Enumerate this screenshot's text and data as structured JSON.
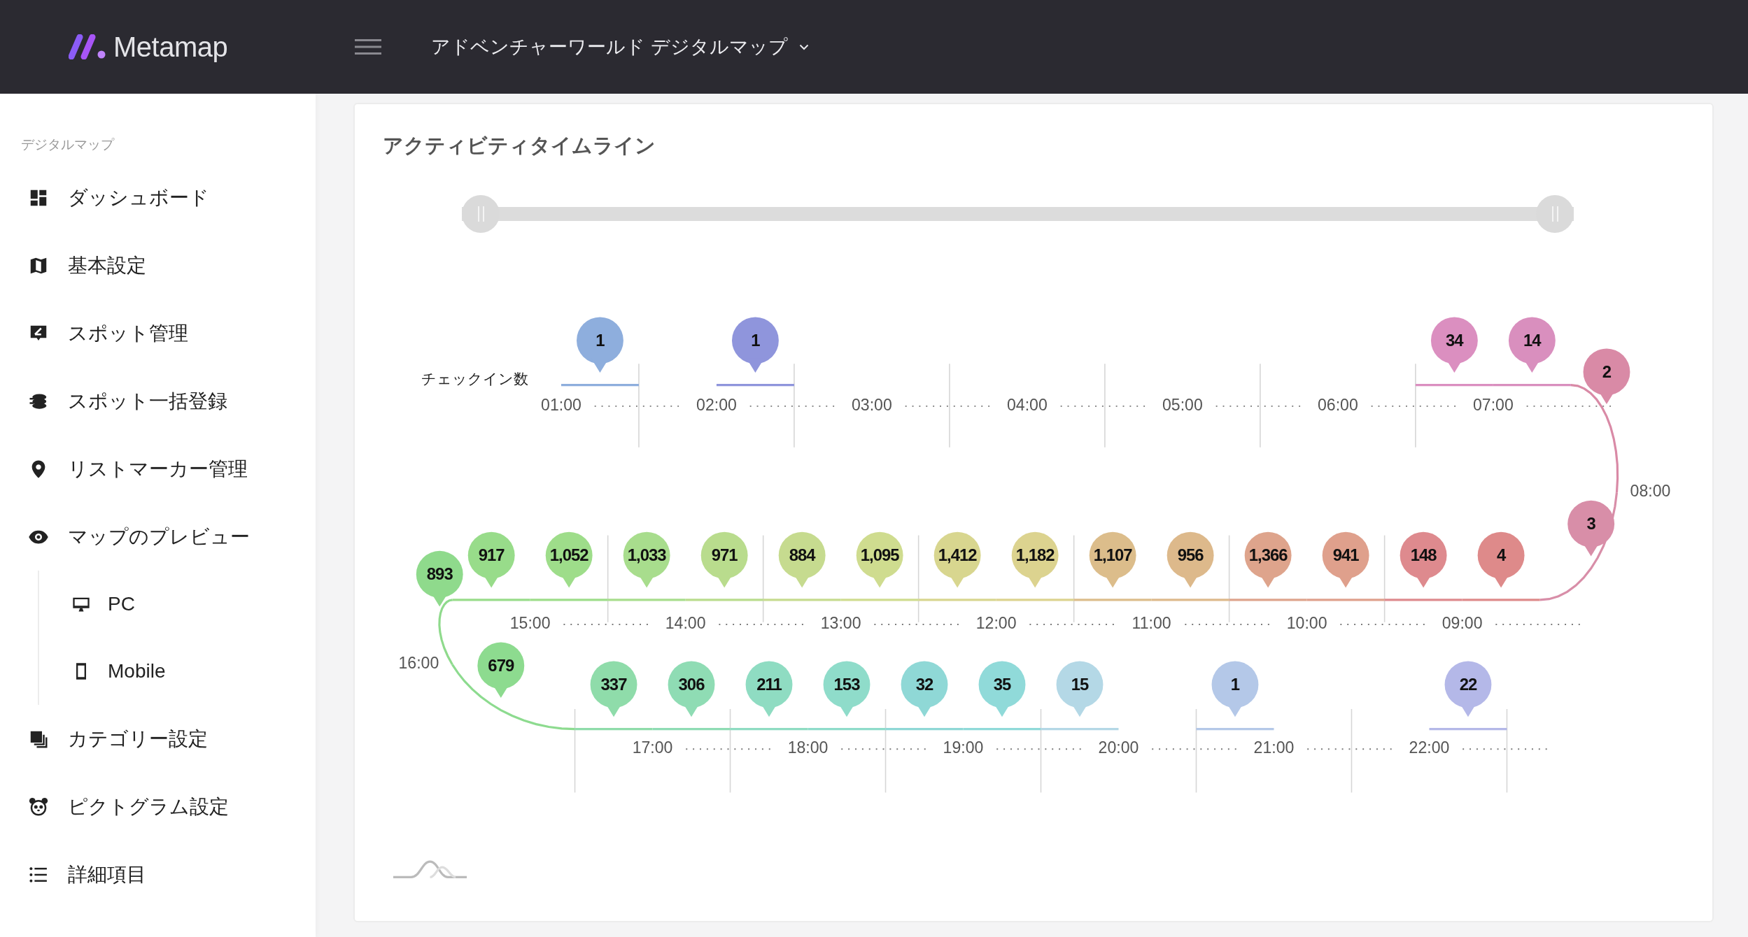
{
  "header": {
    "logo": "Metamap",
    "project": "アドベンチャーワールド デジタルマップ"
  },
  "sidebar": {
    "section": "デジタルマップ",
    "items": [
      {
        "label": "ダッシュボード",
        "kind": "dashboard"
      },
      {
        "label": "基本設定",
        "kind": "map"
      },
      {
        "label": "スポット管理",
        "kind": "spot"
      },
      {
        "label": "スポット一括登録",
        "kind": "stack"
      },
      {
        "label": "リストマーカー管理",
        "kind": "pin"
      },
      {
        "label": "マップのプレビュー",
        "kind": "eye",
        "children": [
          {
            "label": "PC",
            "kind": "monitor"
          },
          {
            "label": "Mobile",
            "kind": "phone"
          }
        ]
      },
      {
        "label": "カテゴリー設定",
        "kind": "category"
      },
      {
        "label": "ピクトグラム設定",
        "kind": "panda"
      },
      {
        "label": "詳細項目",
        "kind": "list"
      }
    ]
  },
  "card": {
    "title": "アクティビティタイムライン",
    "slider": {
      "level": 1
    },
    "timeline": {
      "label": "チェックイン数",
      "rows": [
        {
          "hours": [
            {
              "time": "01:00",
              "late": {
                "count": "1",
                "color": "#8eaedd"
              }
            },
            {
              "time": "02:00",
              "late": {
                "count": "1",
                "color": "#8f95dc"
              }
            },
            {
              "time": "03:00"
            },
            {
              "time": "04:00"
            },
            {
              "time": "05:00"
            },
            {
              "time": "06:00"
            },
            {
              "time": "07:00",
              "early": {
                "count": "34",
                "color": "#db8fc0"
              },
              "late": {
                "count": "14",
                "color": "#d98fbe"
              }
            },
            {
              "time": "08:00",
              "early": {
                "count": "2",
                "color": "#d98aa6"
              },
              "late": {
                "count": "3",
                "color": "#d88ea8"
              }
            }
          ]
        },
        {
          "hours": [
            {
              "time": "15:00",
              "late": {
                "count": "917",
                "color": "#98dc8a"
              },
              "early": {
                "count": "1,052",
                "color": "#9edd8a"
              }
            },
            {
              "time": "14:00",
              "late": {
                "count": "1,033",
                "color": "#a8dd8d"
              },
              "early": {
                "count": "971",
                "color": "#b9dc8d"
              }
            },
            {
              "time": "13:00",
              "late": {
                "count": "884",
                "color": "#c6db8f"
              },
              "early": {
                "count": "1,095",
                "color": "#cfdc8f"
              }
            },
            {
              "time": "12:00",
              "late": {
                "count": "1,412",
                "color": "#d8d68f"
              },
              "early": {
                "count": "1,182",
                "color": "#dcd38f"
              }
            },
            {
              "time": "11:00",
              "late": {
                "count": "1,107",
                "color": "#dcbd8b"
              },
              "early": {
                "count": "956",
                "color": "#ddb98b"
              }
            },
            {
              "time": "10:00",
              "late": {
                "count": "1,366",
                "color": "#dea48c"
              },
              "early": {
                "count": "941",
                "color": "#dfa08c"
              }
            },
            {
              "time": "09:00",
              "late": {
                "count": "148",
                "color": "#de8a8e"
              },
              "early": {
                "count": "4",
                "color": "#de8a8a"
              }
            }
          ]
        },
        {
          "hours": [
            {
              "time": "16:00",
              "early": {
                "count": "893",
                "color": "#8fda8c"
              },
              "late": {
                "count": "679",
                "color": "#8ddb8f"
              }
            },
            {
              "time": "17:00",
              "early": {
                "count": "337",
                "color": "#8fdcaa"
              },
              "late": {
                "count": "306",
                "color": "#8fdcb4"
              }
            },
            {
              "time": "18:00",
              "early": {
                "count": "211",
                "color": "#8fdcc2"
              },
              "late": {
                "count": "153",
                "color": "#8fdcca"
              }
            },
            {
              "time": "19:00",
              "early": {
                "count": "32",
                "color": "#8fd8d6"
              },
              "late": {
                "count": "35",
                "color": "#90dad9"
              }
            },
            {
              "time": "20:00",
              "early": {
                "count": "15",
                "color": "#b4d8e6"
              }
            },
            {
              "time": "21:00",
              "early": {
                "count": "1",
                "color": "#b4c8e8"
              }
            },
            {
              "time": "22:00",
              "late": {
                "count": "22",
                "color": "#b4b8e8"
              }
            }
          ]
        }
      ]
    }
  }
}
